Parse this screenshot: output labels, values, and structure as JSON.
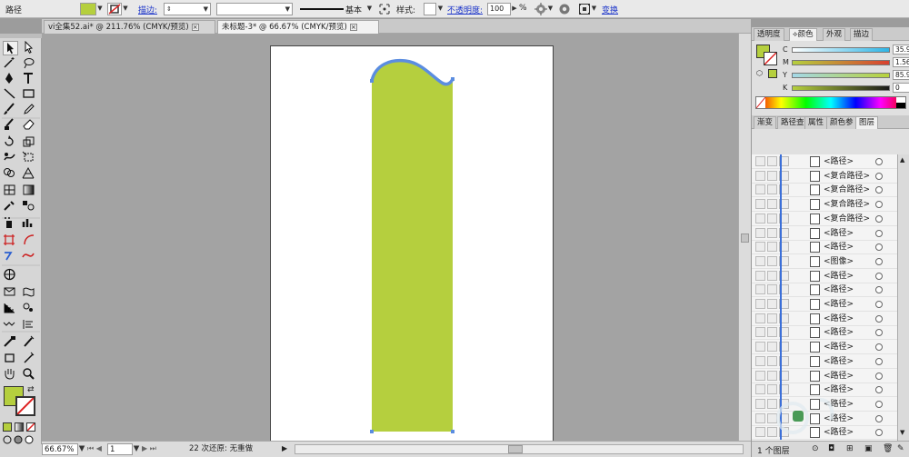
{
  "control_bar": {
    "selection_type": "路径",
    "stroke_label": "描边:",
    "brush_label": "基本",
    "style_label": "样式:",
    "opacity_label": "不透明度:",
    "opacity_value": "100",
    "opacity_unit": "%",
    "transform_link": "变换",
    "fill_color": "#b5cf3e"
  },
  "document_tabs": [
    {
      "label": "vi全集52.ai* @ 211.76% (CMYK/预览)"
    },
    {
      "label": "未标题-3* @ 66.67% (CMYK/预览)"
    }
  ],
  "status_bar": {
    "zoom": "66.67%",
    "page": "1",
    "undo_text": "22 次还原: 无重做"
  },
  "color_panel": {
    "tabs": [
      "透明度",
      "颜色",
      "外观",
      "描边"
    ],
    "active_tab": "颜色",
    "channels": [
      {
        "label": "C",
        "value": "35.94",
        "unit": "%"
      },
      {
        "label": "M",
        "value": "1.56",
        "unit": "%"
      },
      {
        "label": "Y",
        "value": "85.94",
        "unit": "%"
      },
      {
        "label": "K",
        "value": "0",
        "unit": "%"
      }
    ],
    "fill_color": "#b5cf3e"
  },
  "layers_panel": {
    "tabs": [
      "渐变",
      "路径查",
      "属性",
      "颜色参",
      "图层"
    ],
    "active_tab": "图层",
    "items": [
      {
        "name": "<路径>"
      },
      {
        "name": "<复合路径>"
      },
      {
        "name": "<复合路径>"
      },
      {
        "name": "<复合路径>"
      },
      {
        "name": "<复合路径>"
      },
      {
        "name": "<路径>"
      },
      {
        "name": "<路径>"
      },
      {
        "name": "<图像>"
      },
      {
        "name": "<路径>"
      },
      {
        "name": "<路径>"
      },
      {
        "name": "<路径>"
      },
      {
        "name": "<路径>"
      },
      {
        "name": "<路径>"
      },
      {
        "name": "<路径>"
      },
      {
        "name": "<路径>"
      },
      {
        "name": "<路径>"
      },
      {
        "name": "<路径>"
      },
      {
        "name": "<路径>"
      },
      {
        "name": "<路径>"
      },
      {
        "name": "<路径>"
      }
    ],
    "footer_text": "1 个图层"
  },
  "artwork": {
    "shape_fill": "#b5cf3e",
    "path_stroke": "#5b8de0"
  }
}
